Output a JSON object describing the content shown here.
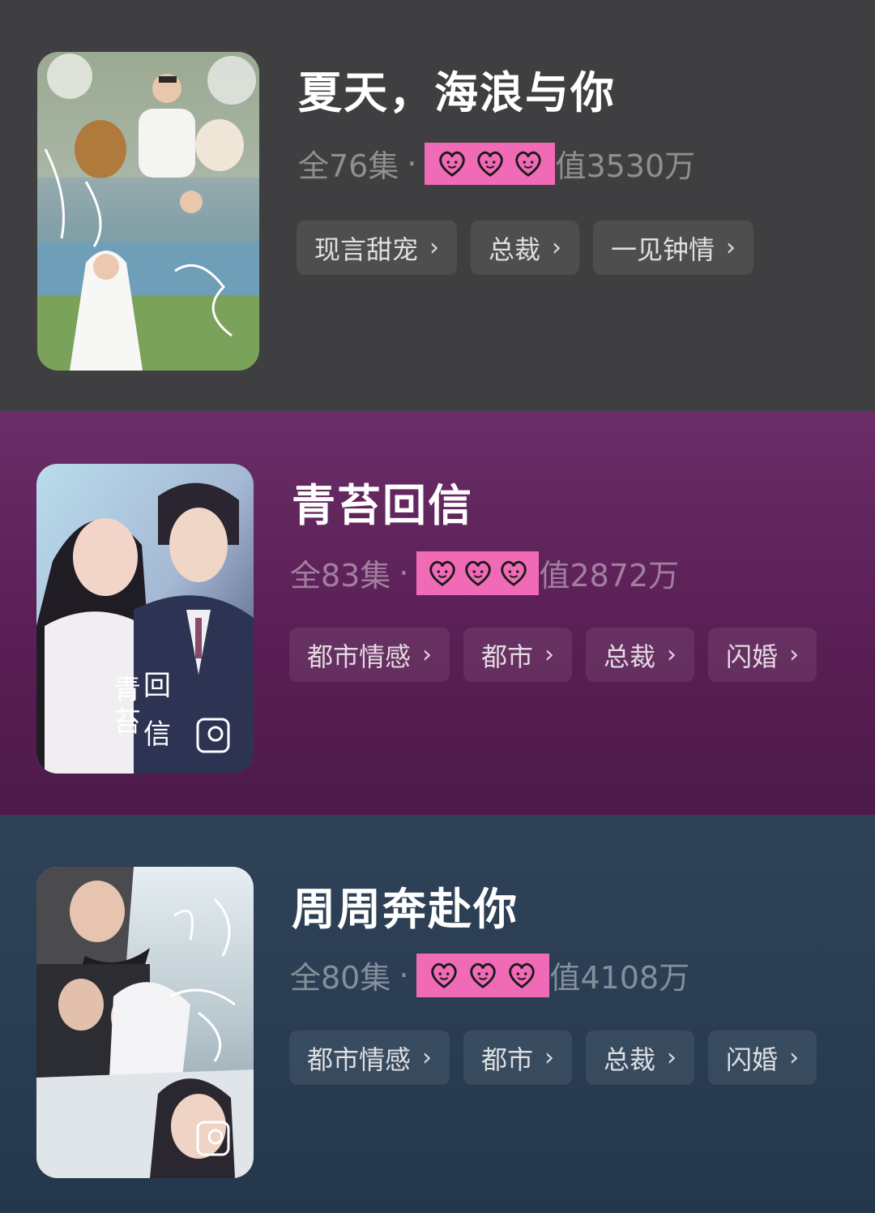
{
  "shows": [
    {
      "title": "夏天，海浪与你",
      "episodes": "全76集",
      "separator": "·",
      "heat": "值3530万",
      "tags": [
        "现言甜宠",
        "总裁",
        "一见钟情"
      ],
      "poster_icon": "wedding-poster-image"
    },
    {
      "title": "青苔回信",
      "episodes": "全83集",
      "separator": "·",
      "heat": "值2872万",
      "tags": [
        "都市情感",
        "都市",
        "总裁",
        "闪婚"
      ],
      "poster_icon": "couple-poster-image"
    },
    {
      "title": "周周奔赴你",
      "episodes": "全80集",
      "separator": "·",
      "heat": "值4108万",
      "tags": [
        "都市情感",
        "都市",
        "总裁",
        "闪婚"
      ],
      "poster_icon": "wedding-kiss-poster-image"
    }
  ],
  "chevron": "›",
  "colors": {
    "censor_pink": "#f06ab5",
    "card1_bg": "#3f3f41",
    "card2_bg": "#5a1f55",
    "card3_bg": "#2a3d52"
  }
}
